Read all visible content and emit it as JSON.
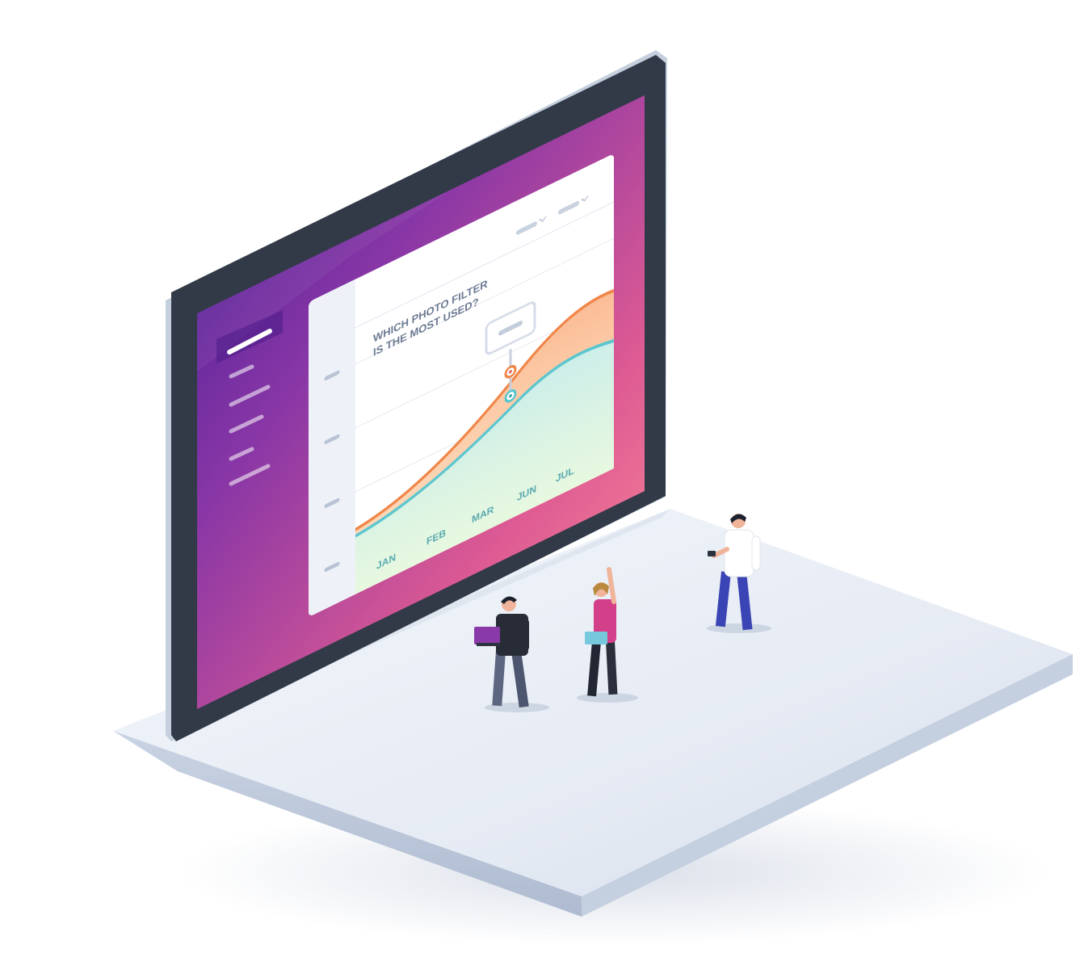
{
  "chart": {
    "title_line1": "WHICH PHOTO FILTER",
    "title_line2": "IS THE MOST USED?",
    "months": [
      "JAN",
      "FEB",
      "MAR",
      "JUN",
      "JUL"
    ]
  },
  "chart_data": {
    "type": "area",
    "title": "WHICH PHOTO FILTER IS THE MOST USED?",
    "categories": [
      "JAN",
      "FEB",
      "MAR",
      "JUN",
      "JUL"
    ],
    "grid": true,
    "legend": "none"
  },
  "colors": {
    "screen_gradient": [
      "#4a1f9e",
      "#8e3aa8",
      "#e0578f",
      "#ff8a9a"
    ],
    "bezel": "#323a48",
    "base_top": "#e7ecf4",
    "orange_series": "#f08a4b",
    "teal_series": "#5cc8cf",
    "orange_fill": "#fbc8a4",
    "teal_fill": "#d6f3e4"
  },
  "icons": [
    "sidebar-menu-icon",
    "dropdown-chevron-icon",
    "tooltip-marker-icon"
  ]
}
